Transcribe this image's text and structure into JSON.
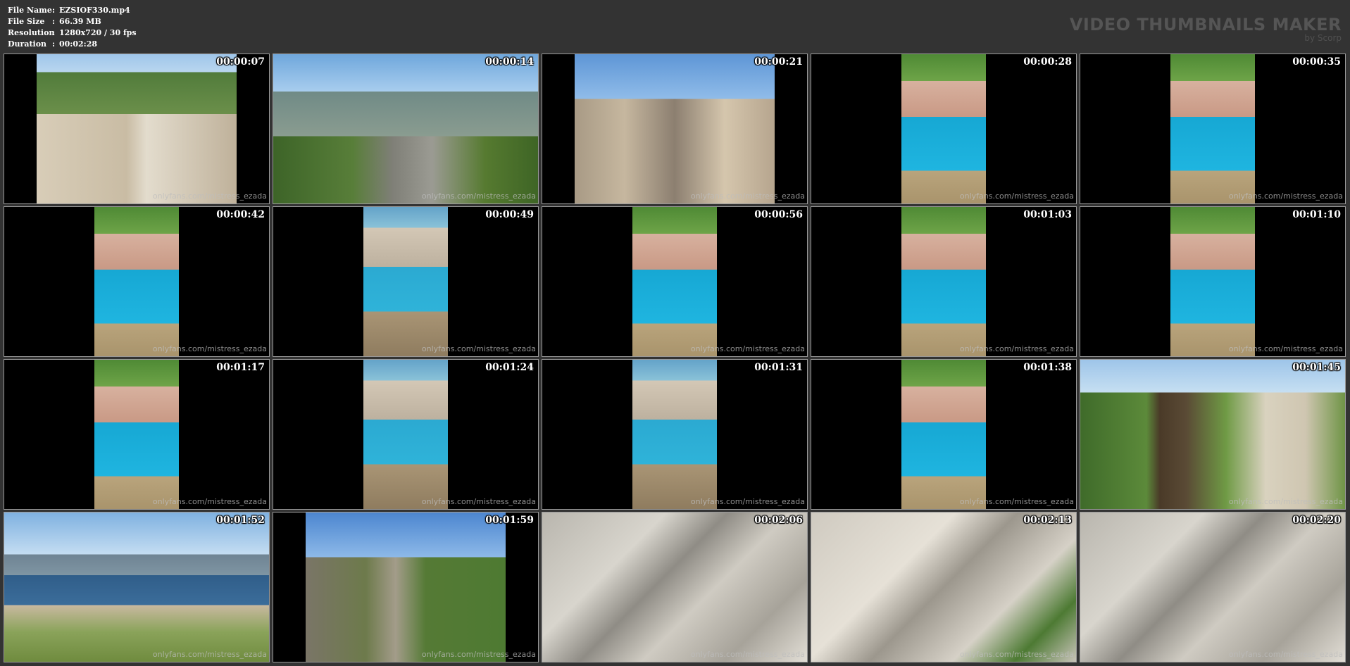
{
  "info": {
    "file_name_label": "File Name",
    "file_name": "EZSIOF330.mp4",
    "file_size_label": "File Size",
    "file_size": "66.39 MB",
    "resolution_label": "Resolution",
    "resolution": "1280x720 / 30 fps",
    "duration_label": "Duration",
    "duration": "00:02:28",
    "separator": ":"
  },
  "brand": {
    "title": "VIDEO THUMBNAILS MAKER",
    "subtitle": "by Scorp"
  },
  "thumbnails": [
    {
      "time": "00:00:07",
      "watermark": "onlyfans.com/mistress_ezada"
    },
    {
      "time": "00:00:14",
      "watermark": "onlyfans.com/mistress_ezada"
    },
    {
      "time": "00:00:21",
      "watermark": "onlyfans.com/mistress_ezada"
    },
    {
      "time": "00:00:28",
      "watermark": "onlyfans.com/mistress_ezada"
    },
    {
      "time": "00:00:35",
      "watermark": "onlyfans.com/mistress_ezada"
    },
    {
      "time": "00:00:42",
      "watermark": "onlyfans.com/mistress_ezada"
    },
    {
      "time": "00:00:49",
      "watermark": "onlyfans.com/mistress_ezada"
    },
    {
      "time": "00:00:56",
      "watermark": "onlyfans.com/mistress_ezada"
    },
    {
      "time": "00:01:03",
      "watermark": "onlyfans.com/mistress_ezada"
    },
    {
      "time": "00:01:10",
      "watermark": "onlyfans.com/mistress_ezada"
    },
    {
      "time": "00:01:17",
      "watermark": "onlyfans.com/mistress_ezada"
    },
    {
      "time": "00:01:24",
      "watermark": "onlyfans.com/mistress_ezada"
    },
    {
      "time": "00:01:31",
      "watermark": "onlyfans.com/mistress_ezada"
    },
    {
      "time": "00:01:38",
      "watermark": "onlyfans.com/mistress_ezada"
    },
    {
      "time": "00:01:45",
      "watermark": "onlyfans.com/mistress_ezada"
    },
    {
      "time": "00:01:52",
      "watermark": "onlyfans.com/mistress_ezada"
    },
    {
      "time": "00:01:59",
      "watermark": "onlyfans.com/mistress_ezada"
    },
    {
      "time": "00:02:06",
      "watermark": "onlyfans.com/mistress_ezada"
    },
    {
      "time": "00:02:13",
      "watermark": "onlyfans.com/mistress_ezada"
    },
    {
      "time": "00:02:20",
      "watermark": "onlyfans.com/mistress_ezada"
    }
  ]
}
